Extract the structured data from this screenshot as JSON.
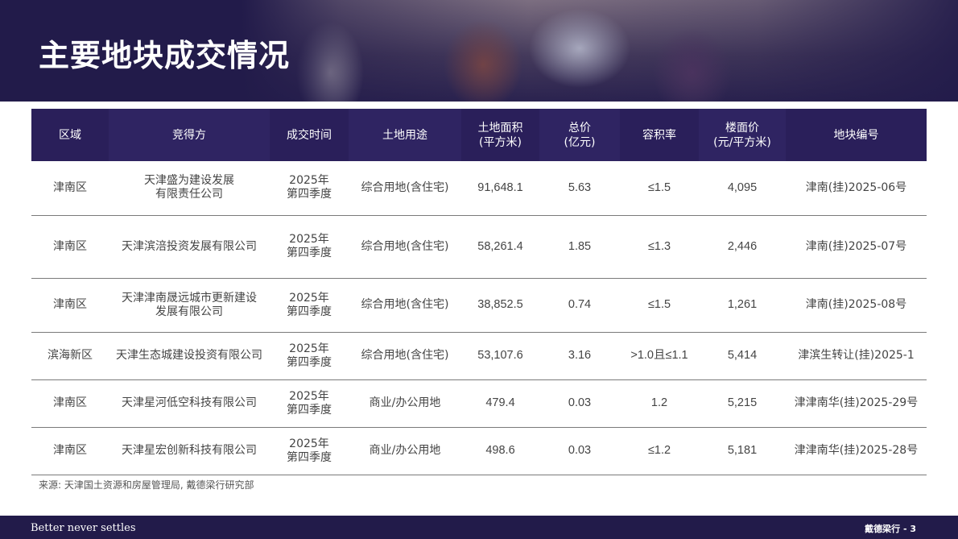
{
  "header": {
    "title": "主要地块成交情况"
  },
  "table": {
    "columns": [
      [
        "区域"
      ],
      [
        "竞得方"
      ],
      [
        "成交时间"
      ],
      [
        "土地用途"
      ],
      [
        "土地面积",
        "(平方米)"
      ],
      [
        "总价",
        "(亿元)"
      ],
      [
        "容积率"
      ],
      [
        "楼面价",
        "(元/平方米)"
      ],
      [
        "地块编号"
      ]
    ],
    "rows": [
      {
        "district": "津南区",
        "winner": [
          "天津盛为建设发展",
          "有限责任公司"
        ],
        "time": [
          "2025年",
          "第四季度"
        ],
        "use": "综合用地(含住宅)",
        "area": "91,648.1",
        "price": "5.63",
        "far": "≤1.5",
        "unit_price": "4,095",
        "plot_id": "津南(挂)2025-06号"
      },
      {
        "district": "津南区",
        "winner": [
          "天津滨涪投资发展有限公司"
        ],
        "time": [
          "2025年",
          "第四季度"
        ],
        "use": "综合用地(含住宅)",
        "area": "58,261.4",
        "price": "1.85",
        "far": "≤1.3",
        "unit_price": "2,446",
        "plot_id": "津南(挂)2025-07号"
      },
      {
        "district": "津南区",
        "winner": [
          "天津津南晟远城市更新建设",
          "发展有限公司"
        ],
        "time": [
          "2025年",
          "第四季度"
        ],
        "use": "综合用地(含住宅)",
        "area": "38,852.5",
        "price": "0.74",
        "far": "≤1.5",
        "unit_price": "1,261",
        "plot_id": "津南(挂)2025-08号"
      },
      {
        "district": "滨海新区",
        "winner": [
          "天津生态城建设投资有限公司"
        ],
        "time": [
          "2025年",
          "第四季度"
        ],
        "use": "综合用地(含住宅)",
        "area": "53,107.6",
        "price": "3.16",
        "far": ">1.0且≤1.1",
        "unit_price": "5,414",
        "plot_id": "津滨生转让(挂)2025-1"
      },
      {
        "district": "津南区",
        "winner": [
          "天津星河低空科技有限公司"
        ],
        "time": [
          "2025年",
          "第四季度"
        ],
        "use": "商业/办公用地",
        "area": "479.4",
        "price": "0.03",
        "far": "1.2",
        "unit_price": "5,215",
        "plot_id": "津津南华(挂)2025-29号"
      },
      {
        "district": "津南区",
        "winner": [
          "天津星宏创新科技有限公司"
        ],
        "time": [
          "2025年",
          "第四季度"
        ],
        "use": "商业/办公用地",
        "area": "498.6",
        "price": "0.03",
        "far": "≤1.2",
        "unit_price": "5,181",
        "plot_id": "津津南华(挂)2025-28号"
      }
    ]
  },
  "source": "来源: 天津国土资源和房屋管理局, 戴德梁行研究部",
  "footer": {
    "slogan": "Better never settles",
    "brand": "戴德梁行 - 3"
  }
}
